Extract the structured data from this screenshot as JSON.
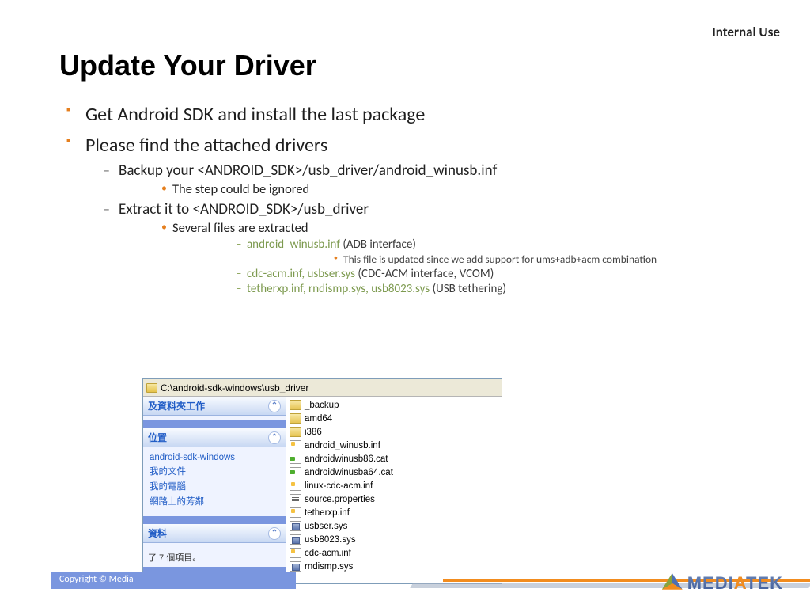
{
  "classification": "Internal Use",
  "title": "Update Your Driver",
  "bullets": {
    "b1": "Get Android SDK and install the last package",
    "b2": "Please find the attached drivers",
    "s1a": "Backup your ",
    "s1a_path": "<ANDROID_SDK>/usb_driver/android_winusb.inf",
    "s1a_sub": "The step could be ignored",
    "s1b": "Extract it to ",
    "s1b_path": "<ANDROID_SDK>/usb_driver",
    "s1b_sub": "Several files are extracted",
    "f1_name": "android_winusb.inf",
    "f1_desc": " (ADB interface)",
    "f1_note": "This file is updated since we add support for ums+adb+acm combination",
    "f2_name": "cdc-acm.inf, usbser.sys",
    "f2_desc": " (CDC-ACM interface, VCOM)",
    "f3_name": "tetherxp.inf, rndismp.sys, usb8023.sys",
    "f3_desc": " (USB tethering)"
  },
  "explorer": {
    "addressbar": "C:\\android-sdk-windows\\usb_driver",
    "task1_head": "及資料夾工作",
    "task2_head": "位置",
    "places": [
      "android-sdk-windows",
      "我的文件",
      "我的電腦",
      "網路上的芳鄰"
    ],
    "task3_head": "資料",
    "status": "了 7 個項目。",
    "files": [
      {
        "ic": "ic-folder",
        "name": "_backup"
      },
      {
        "ic": "ic-folder",
        "name": "amd64"
      },
      {
        "ic": "ic-folder",
        "name": "i386"
      },
      {
        "ic": "ic-inf",
        "name": "android_winusb.inf"
      },
      {
        "ic": "ic-cat",
        "name": "androidwinusb86.cat"
      },
      {
        "ic": "ic-cat",
        "name": "androidwinusba64.cat"
      },
      {
        "ic": "ic-inf",
        "name": "linux-cdc-acm.inf"
      },
      {
        "ic": "ic-prop",
        "name": "source.properties"
      },
      {
        "ic": "ic-inf",
        "name": "tetherxp.inf"
      },
      {
        "ic": "ic-sys",
        "name": "usbser.sys"
      },
      {
        "ic": "ic-sys",
        "name": "usb8023.sys"
      },
      {
        "ic": "ic-inf",
        "name": "cdc-acm.inf"
      },
      {
        "ic": "ic-sys",
        "name": "rndismp.sys"
      }
    ]
  },
  "footer": {
    "copyright": "Copyright © Media",
    "brand_prefix": "MEDI",
    "brand_mid": "A",
    "brand_suffix": "TEK"
  }
}
